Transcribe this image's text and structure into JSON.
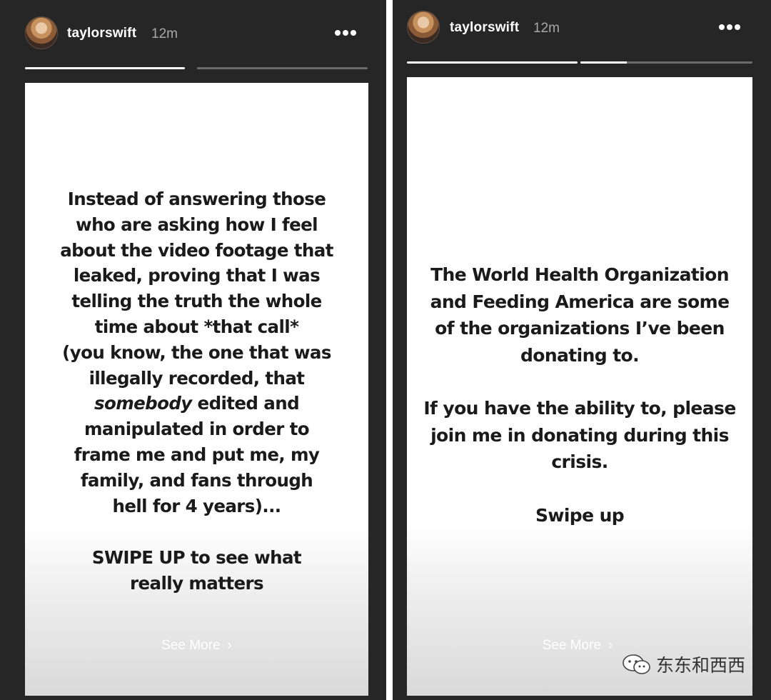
{
  "stories": [
    {
      "username": "taylorswift",
      "time": "12m",
      "progress": [
        1.0,
        0.0
      ],
      "text_before_em": [
        "Instead of answering those",
        "who are asking how I feel",
        "about the video footage that",
        "leaked, proving that I was",
        "telling the truth the whole",
        "time about *that call*",
        "(you know, the one that was",
        "illegally recorded, that"
      ],
      "em_word": "somebody",
      "em_rest": " edited and",
      "text_after_em": [
        "manipulated in order to",
        "frame me and put me, my",
        "family, and fans through",
        "hell for 4 years)..."
      ],
      "cta": [
        "SWIPE UP to see what",
        "really matters"
      ],
      "see_more": "See More",
      "see_more_chevron": "›"
    },
    {
      "username": "taylorswift",
      "time": "12m",
      "progress": [
        1.0,
        0.27
      ],
      "paragraph1": [
        "The World Health Organization",
        "and Feeding America are some",
        "of the organizations I’ve been",
        "donating to."
      ],
      "paragraph2": [
        "If you have the ability to, please",
        "join me in donating during this",
        "crisis."
      ],
      "cta": "Swipe up",
      "see_more": "See More",
      "see_more_chevron": "›"
    }
  ],
  "watermark": {
    "text": "东东和西西",
    "icon": "wechat-icon"
  },
  "icons": {
    "more": "more-dots-icon",
    "avatar": "profile-avatar"
  }
}
